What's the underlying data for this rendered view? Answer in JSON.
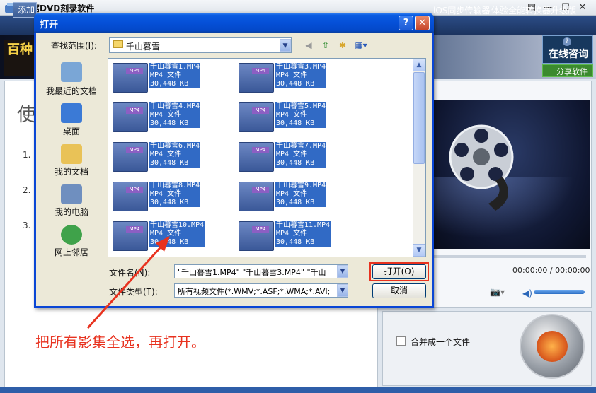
{
  "app": {
    "title": "狸窝DVD刻录软件",
    "add_label": "添加",
    "links": [
      "iOS同步传输器",
      "体验全能转换器升级版"
    ],
    "window_controls": [
      "▤",
      "—",
      "☐",
      "✕"
    ]
  },
  "banner": {
    "promo_text": "百种",
    "online_consult": "在线咨询",
    "help_icon": "?",
    "share_label": "分享软件"
  },
  "guide": {
    "title": "使",
    "steps": [
      "1.",
      "2.",
      "3."
    ]
  },
  "player": {
    "time": "00:00:00 / 00:00:00"
  },
  "bottom": {
    "merge_label": "合并成一个文件"
  },
  "dialog": {
    "title": "打开",
    "help": "?",
    "close": "✕",
    "lookin_label": "查找范围(I):",
    "lookin_value": "千山暮雪",
    "places": [
      {
        "label": "我最近的文档",
        "icon": "recent-documents-icon",
        "color": "#7aa6d6"
      },
      {
        "label": "桌面",
        "icon": "desktop-icon",
        "color": "#3b7ad6"
      },
      {
        "label": "我的文档",
        "icon": "my-documents-icon",
        "color": "#e9c257"
      },
      {
        "label": "我的电脑",
        "icon": "my-computer-icon",
        "color": "#6f8fbf"
      },
      {
        "label": "网上邻居",
        "icon": "network-places-icon",
        "color": "#3fa24a"
      }
    ],
    "files": [
      {
        "name": "千山暮雪1.MP4",
        "type": "MP4 文件",
        "size": "30,448 KB"
      },
      {
        "name": "千山暮雪3.MP4",
        "type": "MP4 文件",
        "size": "30,448 KB"
      },
      {
        "name": "千山暮雪4.MP4",
        "type": "MP4 文件",
        "size": "30,448 KB"
      },
      {
        "name": "千山暮雪5.MP4",
        "type": "MP4 文件",
        "size": "30,448 KB"
      },
      {
        "name": "千山暮雪6.MP4",
        "type": "MP4 文件",
        "size": "30,448 KB"
      },
      {
        "name": "千山暮雪7.MP4",
        "type": "MP4 文件",
        "size": "30,448 KB"
      },
      {
        "name": "千山暮雪8.MP4",
        "type": "MP4 文件",
        "size": "30,448 KB"
      },
      {
        "name": "千山暮雪9.MP4",
        "type": "MP4 文件",
        "size": "30,448 KB"
      },
      {
        "name": "千山暮雪10.MP4",
        "type": "MP4 文件",
        "size": "30,448 KB"
      },
      {
        "name": "千山暮雪11.MP4",
        "type": "MP4 文件",
        "size": "30,448 KB"
      }
    ],
    "file_icon_tag": "MP4",
    "filename_label": "文件名(N):",
    "filename_value": "\"千山暮雪1.MP4\" \"千山暮雪3.MP4\" \"千山",
    "filetype_label": "文件类型(T):",
    "filetype_value": "所有视频文件(*.WMV;*.ASF;*.WMA;*.AVI;",
    "open_label": "打开(O)",
    "cancel_label": "取消"
  },
  "annotation": {
    "text": "把所有影集全选，再打开。",
    "color": "#e8321f"
  }
}
